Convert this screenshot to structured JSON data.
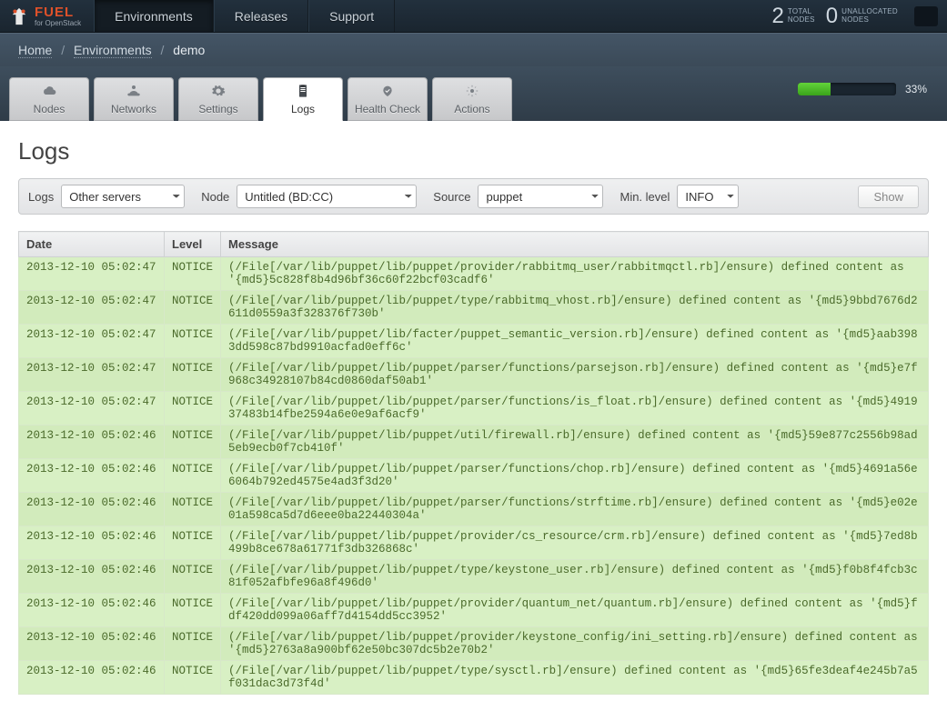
{
  "brand": {
    "name": "FUEL",
    "subtitle": "for OpenStack"
  },
  "nav": {
    "items": [
      "Environments",
      "Releases",
      "Support"
    ],
    "activeIndex": 0
  },
  "stats": {
    "total_num": "2",
    "total_label_top": "TOTAL",
    "total_label_bottom": "NODES",
    "unalloc_num": "0",
    "unalloc_label_top": "UNALLOCATED",
    "unalloc_label_bottom": "NODES"
  },
  "breadcrumb": {
    "home": "Home",
    "env": "Environments",
    "current": "demo"
  },
  "subtabs": {
    "items": [
      "Nodes",
      "Networks",
      "Settings",
      "Logs",
      "Health Check",
      "Actions"
    ],
    "activeIndex": 3
  },
  "progress": {
    "pct": 33,
    "label": "33%"
  },
  "page_title": "Logs",
  "filters": {
    "logs_label": "Logs",
    "logs_value": "Other servers",
    "node_label": "Node",
    "node_value": "Untitled (BD:CC)",
    "source_label": "Source",
    "source_value": "puppet",
    "level_label": "Min. level",
    "level_value": "INFO",
    "show_label": "Show"
  },
  "table": {
    "headers": {
      "date": "Date",
      "level": "Level",
      "message": "Message"
    },
    "rows": [
      {
        "date": "2013-12-10 05:02:47",
        "level": "NOTICE",
        "msg": "(/File[/var/lib/puppet/lib/puppet/provider/rabbitmq_user/rabbitmqctl.rb]/ensure) defined content as '{md5}5c828f8b4d96bf36c60f22bcf03cadf6'"
      },
      {
        "date": "2013-12-10 05:02:47",
        "level": "NOTICE",
        "msg": "(/File[/var/lib/puppet/lib/puppet/type/rabbitmq_vhost.rb]/ensure) defined content as '{md5}9bbd7676d2611d0559a3f328376f730b'"
      },
      {
        "date": "2013-12-10 05:02:47",
        "level": "NOTICE",
        "msg": "(/File[/var/lib/puppet/lib/facter/puppet_semantic_version.rb]/ensure) defined content as '{md5}aab3983dd598c87bd9910acfad0eff6c'"
      },
      {
        "date": "2013-12-10 05:02:47",
        "level": "NOTICE",
        "msg": "(/File[/var/lib/puppet/lib/puppet/parser/functions/parsejson.rb]/ensure) defined content as '{md5}e7f968c34928107b84cd0860daf50ab1'"
      },
      {
        "date": "2013-12-10 05:02:47",
        "level": "NOTICE",
        "msg": "(/File[/var/lib/puppet/lib/puppet/parser/functions/is_float.rb]/ensure) defined content as '{md5}491937483b14fbe2594a6e0e9af6acf9'"
      },
      {
        "date": "2013-12-10 05:02:46",
        "level": "NOTICE",
        "msg": "(/File[/var/lib/puppet/lib/puppet/util/firewall.rb]/ensure) defined content as '{md5}59e877c2556b98ad5eb9ecb0f7cb410f'"
      },
      {
        "date": "2013-12-10 05:02:46",
        "level": "NOTICE",
        "msg": "(/File[/var/lib/puppet/lib/puppet/parser/functions/chop.rb]/ensure) defined content as '{md5}4691a56e6064b792ed4575e4ad3f3d20'"
      },
      {
        "date": "2013-12-10 05:02:46",
        "level": "NOTICE",
        "msg": "(/File[/var/lib/puppet/lib/puppet/parser/functions/strftime.rb]/ensure) defined content as '{md5}e02e01a598ca5d7d6eee0ba22440304a'"
      },
      {
        "date": "2013-12-10 05:02:46",
        "level": "NOTICE",
        "msg": "(/File[/var/lib/puppet/lib/puppet/provider/cs_resource/crm.rb]/ensure) defined content as '{md5}7ed8b499b8ce678a61771f3db326868c'"
      },
      {
        "date": "2013-12-10 05:02:46",
        "level": "NOTICE",
        "msg": "(/File[/var/lib/puppet/lib/puppet/type/keystone_user.rb]/ensure) defined content as '{md5}f0b8f4fcb3c81f052afbfe96a8f496d0'"
      },
      {
        "date": "2013-12-10 05:02:46",
        "level": "NOTICE",
        "msg": "(/File[/var/lib/puppet/lib/puppet/provider/quantum_net/quantum.rb]/ensure) defined content as '{md5}fdf420dd099a06aff7d4154dd5cc3952'"
      },
      {
        "date": "2013-12-10 05:02:46",
        "level": "NOTICE",
        "msg": "(/File[/var/lib/puppet/lib/puppet/provider/keystone_config/ini_setting.rb]/ensure) defined content as '{md5}2763a8a900bf62e50bc307dc5b2e70b2'"
      },
      {
        "date": "2013-12-10 05:02:46",
        "level": "NOTICE",
        "msg": "(/File[/var/lib/puppet/lib/puppet/type/sysctl.rb]/ensure) defined content as '{md5}65fe3deaf4e245b7a5f031dac3d73f4d'"
      }
    ]
  }
}
